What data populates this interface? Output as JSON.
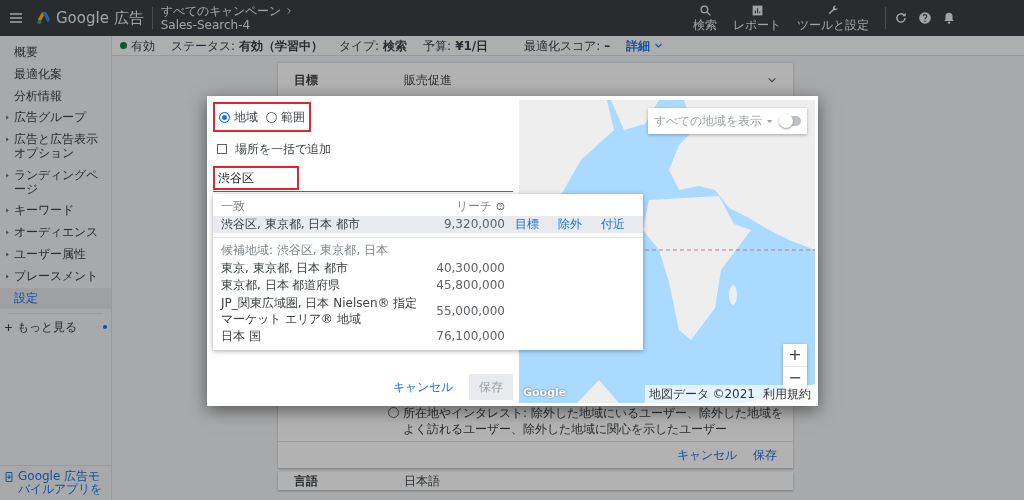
{
  "top_bar": {
    "brand": "Google 広告",
    "breadcrumb": "すべてのキャンペーン",
    "campaign": "Sales-Search-4",
    "tools": [
      {
        "kind": "search",
        "label": "検索"
      },
      {
        "kind": "report",
        "label": "レポート"
      },
      {
        "kind": "tools",
        "label": "ツールと設定"
      }
    ]
  },
  "sidebar": {
    "items": [
      {
        "label": "概要",
        "expandable": false,
        "selected": false
      },
      {
        "label": "最適化案",
        "expandable": false,
        "selected": false
      },
      {
        "label": "分析情報",
        "expandable": false,
        "selected": false
      },
      {
        "label": "広告グループ",
        "expandable": true,
        "selected": false
      },
      {
        "label": "広告と広告表示オプション",
        "expandable": true,
        "selected": false
      },
      {
        "label": "ランディングページ",
        "expandable": true,
        "selected": false
      },
      {
        "label": "キーワード",
        "expandable": true,
        "selected": false
      },
      {
        "label": "オーディエンス",
        "expandable": true,
        "selected": false
      },
      {
        "label": "ユーザー属性",
        "expandable": true,
        "selected": false
      },
      {
        "label": "プレースメント",
        "expandable": true,
        "selected": false
      },
      {
        "label": "設定",
        "expandable": false,
        "selected": true
      }
    ],
    "more": "もっと見る",
    "app_promo": "Google 広告モバイルアプリを"
  },
  "status_bar": {
    "state": "有効",
    "items": [
      {
        "label": "ステータス:",
        "value": "有効（学習中）"
      },
      {
        "label": "タイプ:",
        "value": "検索"
      },
      {
        "label": "予算:",
        "value": "¥1/日"
      },
      {
        "label": "最適化スコア:",
        "value": "–"
      }
    ],
    "details": "詳細"
  },
  "settings": {
    "goal": {
      "label": "目標",
      "value": "販売促進"
    },
    "option": {
      "label": "所在地やインタレスト: 除外した地域にいるユーザー、除外した地域をよく訪れるユーザー、除外した地域に関心を示したユーザー",
      "selected": false
    },
    "cancel": "キャンセル",
    "save": "保存",
    "language": {
      "label": "言語",
      "value": "日本語"
    }
  },
  "dialog": {
    "modes": [
      {
        "label": "地域",
        "selected": true
      },
      {
        "label": "範囲",
        "selected": false
      }
    ],
    "bulk": {
      "label": "場所を一括で追加",
      "checked": false
    },
    "search": {
      "value": "渋谷区"
    },
    "results": {
      "header": "一致",
      "reach_header": "リーチ",
      "match": {
        "name": "渋谷区, 東京都, 日本 都市",
        "reach": "9,320,000",
        "selected": true,
        "actions": [
          "目標",
          "除外",
          "付近"
        ]
      },
      "related_title": "候補地域: 渋谷区, 東京都, 日本",
      "related": [
        {
          "name": "東京, 東京都, 日本 都市",
          "reach": "40,300,000",
          "selected": false
        },
        {
          "name": "東京都, 日本 都道府県",
          "reach": "45,800,000",
          "selected": false
        },
        {
          "name": "JP_関東広域圏, 日本 Nielsen® 指定マーケット エリア® 地域",
          "reach": "55,000,000",
          "selected": false
        },
        {
          "name": "日本 国",
          "reach": "76,100,000",
          "selected": false
        }
      ]
    },
    "cancel": "キャンセル",
    "save": "保存",
    "save_disabled": true,
    "map": {
      "show_all": "すべての地域を表示",
      "show_all_on": false,
      "zoom_in": "+",
      "zoom_out": "−",
      "logo": "Google",
      "attribution": "地図データ ©2021",
      "terms": "利用規約"
    }
  }
}
